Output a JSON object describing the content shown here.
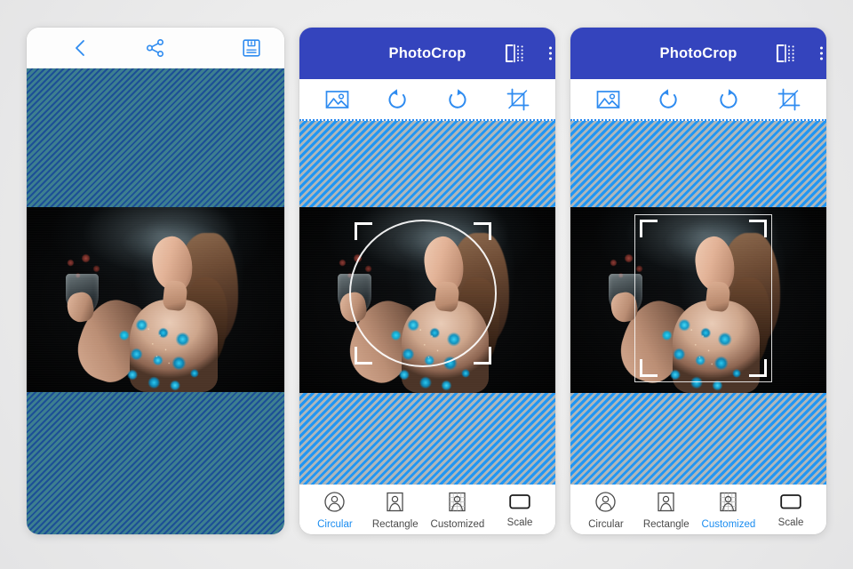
{
  "app": {
    "title": "PhotoCrop",
    "accent_blue": "#3444bd",
    "active_blue": "#1a8cf0",
    "icon_blue": "#2e8bf0"
  },
  "panel1": {
    "name": "preview-panel",
    "toolbar": {
      "back_icon": "chevron-left-icon",
      "share_icon": "share-icon",
      "save_icon": "save-floppy-icon"
    },
    "canvas": {
      "background": "striped-dark-blue"
    }
  },
  "panel2": {
    "name": "circular-crop-panel",
    "appbar": {
      "title": "PhotoCrop",
      "flip_icon": "mirror-flip-icon",
      "menu_icon": "overflow-menu-icon"
    },
    "tools": [
      {
        "name": "gallery-icon",
        "label": "Gallery"
      },
      {
        "name": "rotate-left-icon",
        "label": "Rotate Left"
      },
      {
        "name": "rotate-right-icon",
        "label": "Rotate Right"
      },
      {
        "name": "crop-icon",
        "label": "Crop"
      }
    ],
    "crop_mode": "circular",
    "tabs": [
      {
        "label": "Circular",
        "icon": "circular-crop-icon",
        "active": true
      },
      {
        "label": "Rectangle",
        "icon": "rectangle-crop-icon",
        "active": false
      },
      {
        "label": "Customized",
        "icon": "customized-crop-icon",
        "active": false
      },
      {
        "label": "Scale",
        "icon": "scale-crop-icon",
        "active": false
      }
    ]
  },
  "panel3": {
    "name": "customized-crop-panel",
    "appbar": {
      "title": "PhotoCrop",
      "flip_icon": "mirror-flip-icon",
      "menu_icon": "overflow-menu-icon"
    },
    "tools": [
      {
        "name": "gallery-icon",
        "label": "Gallery"
      },
      {
        "name": "rotate-left-icon",
        "label": "Rotate Left"
      },
      {
        "name": "rotate-right-icon",
        "label": "Rotate Right"
      },
      {
        "name": "crop-icon",
        "label": "Crop"
      }
    ],
    "crop_mode": "customized",
    "tabs": [
      {
        "label": "Circular",
        "icon": "circular-crop-icon",
        "active": false
      },
      {
        "label": "Rectangle",
        "icon": "rectangle-crop-icon",
        "active": false
      },
      {
        "label": "Customized",
        "icon": "customized-crop-icon",
        "active": true
      },
      {
        "label": "Scale",
        "icon": "scale-crop-icon",
        "active": false
      }
    ]
  }
}
